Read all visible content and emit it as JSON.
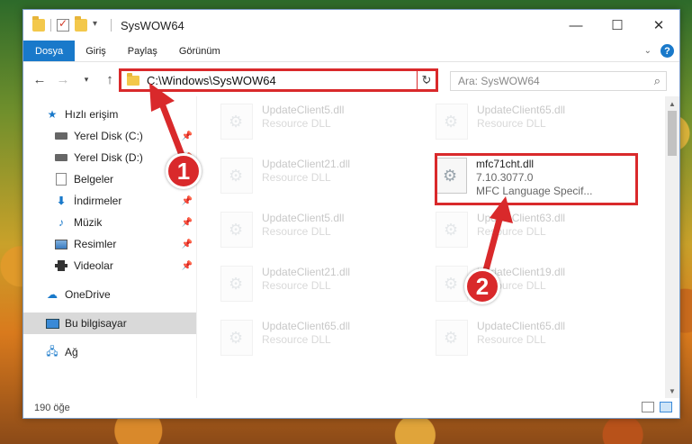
{
  "window": {
    "title": "SysWOW64",
    "controls": {
      "minimize": "—",
      "maximize": "☐",
      "close": "✕"
    }
  },
  "ribbon": {
    "tabs": [
      "Dosya",
      "Giriş",
      "Paylaş",
      "Görünüm"
    ],
    "help": "?"
  },
  "address": {
    "path": "C:\\Windows\\SysWOW64",
    "search_placeholder": "Ara: SysWOW64"
  },
  "sidebar": {
    "items": [
      {
        "label": "Hızlı erişim",
        "icon": "star-icon"
      },
      {
        "label": "Yerel Disk (C:)",
        "icon": "disk-icon",
        "pinned": true
      },
      {
        "label": "Yerel Disk (D:)",
        "icon": "disk-icon",
        "pinned": true
      },
      {
        "label": "Belgeler",
        "icon": "document-icon",
        "pinned": true
      },
      {
        "label": "İndirmeler",
        "icon": "download-icon",
        "pinned": true
      },
      {
        "label": "Müzik",
        "icon": "music-icon",
        "pinned": true
      },
      {
        "label": "Resimler",
        "icon": "picture-icon",
        "pinned": true
      },
      {
        "label": "Videolar",
        "icon": "video-icon",
        "pinned": true
      },
      {
        "label": "OneDrive",
        "icon": "cloud-icon"
      },
      {
        "label": "Bu bilgisayar",
        "icon": "computer-icon",
        "selected": true
      },
      {
        "label": "Ağ",
        "icon": "network-icon"
      }
    ]
  },
  "files": [
    {
      "name": "UpdateClient5.dll",
      "sub": "Resource DLL"
    },
    {
      "name": "UpdateClient65.dll",
      "sub": "Resource DLL"
    },
    {
      "name": "UpdateClient21.dll",
      "sub": "Resource DLL"
    },
    {
      "name": "mfc71cht.dll",
      "version": "7.10.3077.0",
      "desc": "MFC Language Specif..."
    },
    {
      "name": "UpdateClient5.dll",
      "sub": "Resource DLL"
    },
    {
      "name": "UpdateClient63.dll",
      "sub": "Resource DLL"
    },
    {
      "name": "UpdateClient21.dll",
      "sub": "Resource DLL"
    },
    {
      "name": "UpdateClient19.dll",
      "sub": "Resource DLL"
    },
    {
      "name": "UpdateClient65.dll",
      "sub": "Resource DLL"
    },
    {
      "name": "UpdateClient65.dll",
      "sub": "Resource DLL"
    }
  ],
  "status": {
    "count": "190 öğe"
  },
  "annotations": {
    "step1": "1",
    "step2": "2",
    "color": "#d9292b"
  }
}
